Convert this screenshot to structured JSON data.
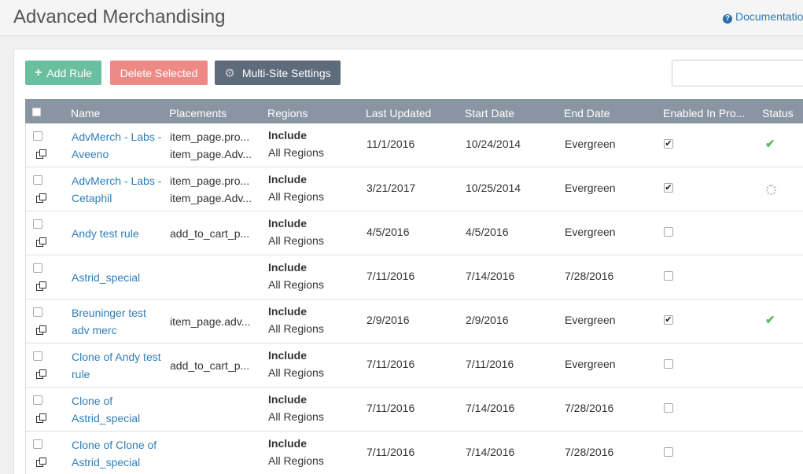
{
  "header": {
    "title": "Advanced Merchandising",
    "doc_link": "Documentation"
  },
  "toolbar": {
    "add_rule": "Add Rule",
    "delete_selected": "Delete Selected",
    "multi_site": "Multi-Site Settings",
    "search_value": ""
  },
  "table": {
    "columns": [
      "Name",
      "Placements",
      "Regions",
      "Last Updated",
      "Start Date",
      "End Date",
      "Enabled In Pro...",
      "Status"
    ],
    "rows": [
      {
        "name": "AdvMerch - Labs - Aveeno",
        "placements": [
          "item_page.pro...",
          "item_page.Adv..."
        ],
        "region_mode": "Include",
        "region_value": "All Regions",
        "last_updated": "11/1/2016",
        "start_date": "10/24/2014",
        "end_date": "Evergreen",
        "enabled": true,
        "status": "ok"
      },
      {
        "name": "AdvMerch - Labs - Cetaphil",
        "placements": [
          "item_page.pro...",
          "item_page.Adv..."
        ],
        "region_mode": "Include",
        "region_value": "All Regions",
        "last_updated": "3/21/2017",
        "start_date": "10/25/2014",
        "end_date": "Evergreen",
        "enabled": true,
        "status": "pending"
      },
      {
        "name": "Andy test rule",
        "placements": [
          "add_to_cart_p..."
        ],
        "region_mode": "Include",
        "region_value": "All Regions",
        "last_updated": "4/5/2016",
        "start_date": "4/5/2016",
        "end_date": "Evergreen",
        "enabled": false,
        "status": "none"
      },
      {
        "name": "Astrid_special",
        "placements": [],
        "region_mode": "Include",
        "region_value": "All Regions",
        "last_updated": "7/11/2016",
        "start_date": "7/14/2016",
        "end_date": "7/28/2016",
        "enabled": false,
        "status": "none"
      },
      {
        "name": "Breuninger test adv merc",
        "placements": [
          "item_page.adv..."
        ],
        "region_mode": "Include",
        "region_value": "All Regions",
        "last_updated": "2/9/2016",
        "start_date": "2/9/2016",
        "end_date": "Evergreen",
        "enabled": true,
        "status": "ok"
      },
      {
        "name": "Clone of Andy test rule",
        "placements": [
          "add_to_cart_p..."
        ],
        "region_mode": "Include",
        "region_value": "All Regions",
        "last_updated": "7/11/2016",
        "start_date": "7/11/2016",
        "end_date": "Evergreen",
        "enabled": false,
        "status": "none"
      },
      {
        "name": "Clone of Astrid_special",
        "placements": [],
        "region_mode": "Include",
        "region_value": "All Regions",
        "last_updated": "7/11/2016",
        "start_date": "7/14/2016",
        "end_date": "7/28/2016",
        "enabled": false,
        "status": "none"
      },
      {
        "name": "Clone of Clone of Astrid_special",
        "placements": [],
        "region_mode": "Include",
        "region_value": "All Regions",
        "last_updated": "7/11/2016",
        "start_date": "7/14/2016",
        "end_date": "7/28/2016",
        "enabled": false,
        "status": "none"
      }
    ]
  },
  "colors": {
    "accent_green": "#6bbfa1",
    "danger_red": "#ee8a86",
    "header_gray": "#8a95a4",
    "link_blue": "#2f7eb8"
  }
}
